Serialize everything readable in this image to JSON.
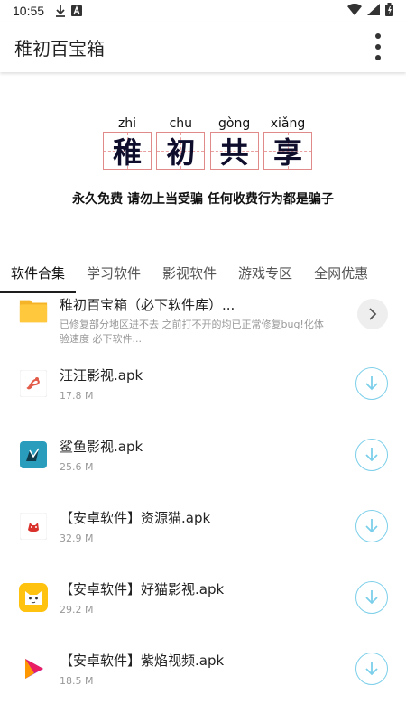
{
  "status": {
    "time": "10:55"
  },
  "app_bar": {
    "title": "稚初百宝箱"
  },
  "banner": {
    "chars": [
      {
        "pinyin": "zhi",
        "char": "稚"
      },
      {
        "pinyin": "chu",
        "char": "初"
      },
      {
        "pinyin": "gòng",
        "char": "共"
      },
      {
        "pinyin": "xiǎng",
        "char": "享"
      }
    ],
    "slogan": "永久免费 请勿上当受骗 任何收费行为都是骗子"
  },
  "tabs": [
    "软件合集",
    "学习软件",
    "影视软件",
    "游戏专区",
    "全网优惠"
  ],
  "featured": {
    "name": "稚初百宝箱（必下软件库）...",
    "desc": "已修复部分地区进不去 之前打不开的均已正常修复bug!化体验速度 必下软件..."
  },
  "apps": [
    {
      "name": "汪汪影视.apk",
      "size": "17.8 M",
      "icon": "wangwang-app-icon"
    },
    {
      "name": "鲨鱼影视.apk",
      "size": "25.6 M",
      "icon": "shark-app-icon"
    },
    {
      "name": "【安卓软件】资源猫.apk",
      "size": "32.9 M",
      "icon": "resource-cat-app-icon"
    },
    {
      "name": "【安卓软件】好猫影视.apk",
      "size": "29.2 M",
      "icon": "haomao-app-icon"
    },
    {
      "name": "【安卓软件】紫焰视频.apk",
      "size": "18.5 M",
      "icon": "ziyan-app-icon"
    }
  ],
  "colors": {
    "accent": "#7ccfea",
    "folder": "#ffc83d",
    "tab_indicator": "#1e1e1e"
  }
}
